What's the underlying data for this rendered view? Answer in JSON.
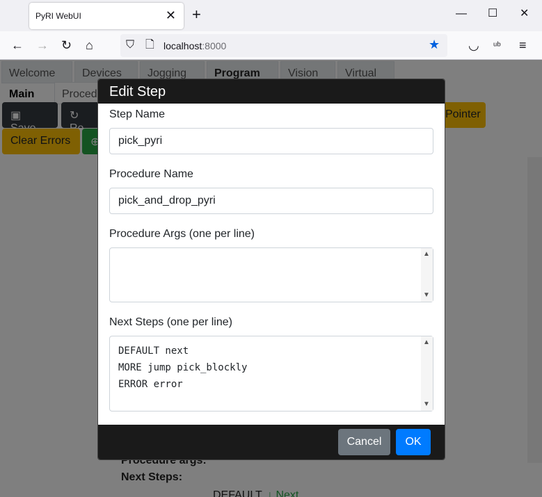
{
  "browser": {
    "tab_title": "PyRI WebUI",
    "tab_close": "✕",
    "new_tab": "+",
    "url_host": "localhost",
    "url_port": ":8000",
    "window_controls": {
      "minimize": "—",
      "maximize": "☐",
      "close": "✕"
    },
    "nav_icons": {
      "back": "←",
      "forward": "→",
      "reload": "↻",
      "home": "⌂",
      "shield": "⛉",
      "page": "🗋",
      "star": "★",
      "pocket": "◡",
      "ublock": "ᵘᵇ",
      "menu": "≡"
    }
  },
  "app": {
    "top_tabs": [
      "Welcome",
      "Devices",
      "Jogging",
      "Program",
      "Vision",
      "Virtual"
    ],
    "sub_tabs": [
      "Main",
      "Proced"
    ],
    "toolbar": {
      "save_label": "Save",
      "reload_label": "Re",
      "pointer_label": "Pointer",
      "clear_errors_label": "Clear Errors"
    },
    "card": {
      "procedure_args_label": "Procedure args:",
      "next_steps_label": "Next Steps:",
      "default_text": "DEFAULT",
      "next_link": "Next"
    }
  },
  "modal": {
    "title": "Edit Step",
    "step_name_label": "Step Name",
    "step_name_value": "pick_pyri",
    "procedure_name_label": "Procedure Name",
    "procedure_name_value": "pick_and_drop_pyri",
    "procedure_args_label": "Procedure Args (one per line)",
    "procedure_args_value": "",
    "next_steps_label": "Next Steps (one per line)",
    "next_steps_lines": [
      "DEFAULT next",
      "MORE jump pick_blockly",
      "ERROR error"
    ],
    "cancel_label": "Cancel",
    "ok_label": "OK"
  },
  "colors": {
    "ok_button": "#007bff",
    "cancel_button": "#6c757d",
    "warning_button": "#ffc107",
    "dark_button": "#343a40",
    "success_button": "#28a745",
    "modal_header": "#1a1a1a",
    "star_icon": "#0060df"
  }
}
